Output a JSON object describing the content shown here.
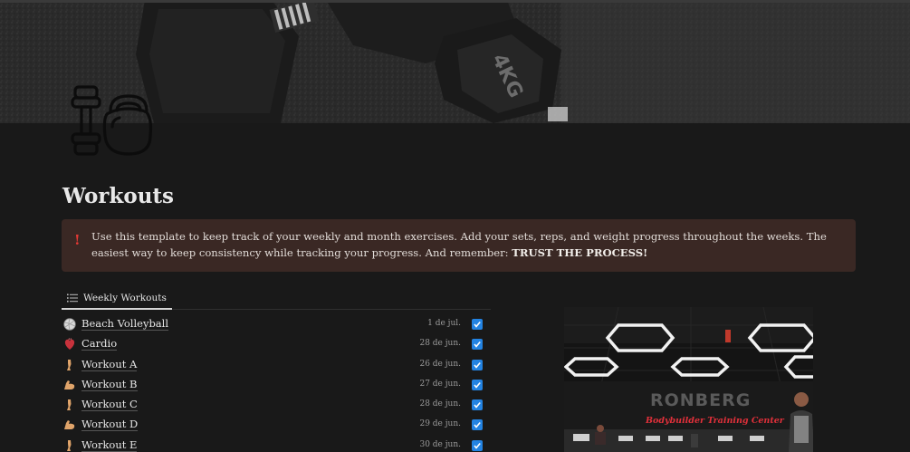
{
  "cover": {
    "description_icon": "dumbbell-cover-image",
    "dumbbell_text": "4KG"
  },
  "page_icon": "dumbbell-kettlebell-icon",
  "title": "Workouts",
  "callout": {
    "icon": "exclamation-icon",
    "text_main": "Use this template to keep track of your weekly and month exercises. Add your sets, reps, and weight progress throughout the weeks. The easiest way to keep consistency while tracking your progress. And remember: ",
    "text_bold": "TRUST THE PROCESS!"
  },
  "tab": {
    "label": "Weekly Workouts",
    "icon": "list-icon"
  },
  "workouts": [
    {
      "name": "Beach Volleyball",
      "date": "1 de jul.",
      "icon": "volleyball-icon",
      "done": true
    },
    {
      "name": "Cardio",
      "date": "28 de jun.",
      "icon": "heart-icon",
      "done": true
    },
    {
      "name": "Workout A",
      "date": "26 de jun.",
      "icon": "leg-icon",
      "done": true
    },
    {
      "name": "Workout B",
      "date": "27 de jun.",
      "icon": "flexed-biceps-icon",
      "done": true
    },
    {
      "name": "Workout C",
      "date": "28 de jun.",
      "icon": "leg-icon",
      "done": true
    },
    {
      "name": "Workout D",
      "date": "29 de jun.",
      "icon": "flexed-biceps-icon",
      "done": true
    },
    {
      "name": "Workout E",
      "date": "30 de jun.",
      "icon": "leg-icon",
      "done": true
    }
  ],
  "gym_image": {
    "sign_text": "RONBERG",
    "neon_text": "Bodybuilder Training Center"
  },
  "colors": {
    "background": "#191919",
    "callout_bg": "#3a2824",
    "checkbox": "#2383e2",
    "alert_red": "#e53935",
    "neon_red": "#e0303a"
  }
}
